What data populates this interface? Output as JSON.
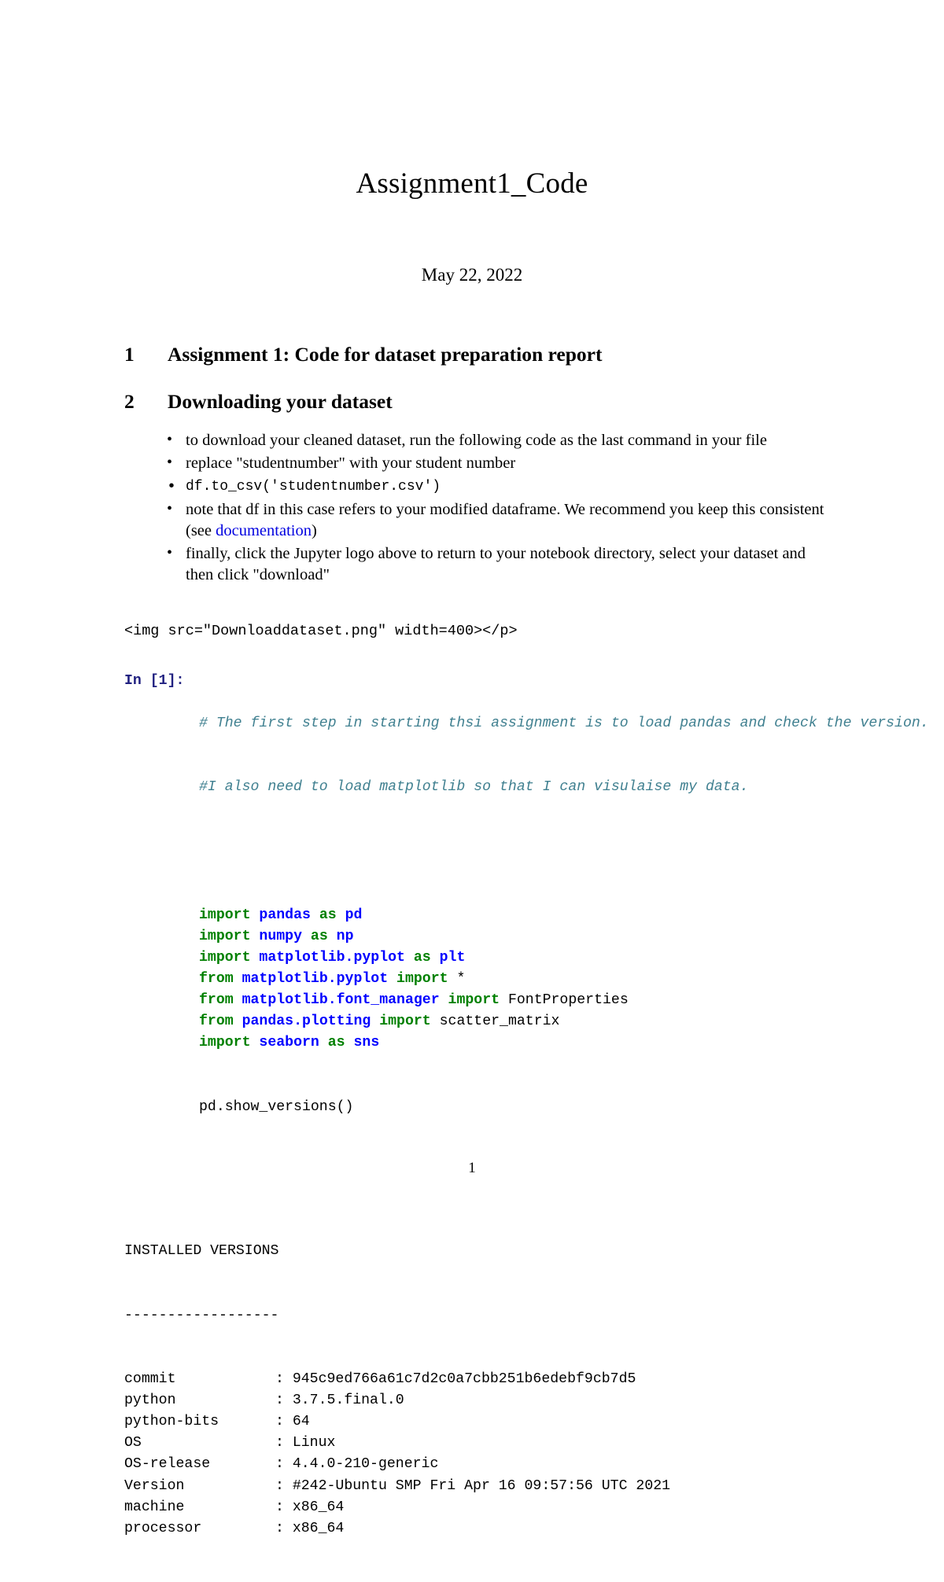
{
  "document": {
    "title": "Assignment1_Code",
    "date": "May 22, 2022",
    "page_number": "1"
  },
  "sections": [
    {
      "number": "1",
      "heading": "Assignment 1: Code for dataset preparation report"
    },
    {
      "number": "2",
      "heading": "Downloading your dataset"
    }
  ],
  "bullets": {
    "item1": "to download your cleaned dataset, run the following code as the last command in your file",
    "item2": "replace \"studentnumber\" with your student number",
    "item3": "df.to_csv('studentnumber.csv')",
    "item4_before": "note that df in this case refers to your modified dataframe.  We recommend you keep this consistent (see ",
    "item4_link": "documentation",
    "item4_after": ")",
    "item5": "finally, click the Jupyter logo above to return to your notebook directory, select your dataset and then click \"download\""
  },
  "raw_html_line": "<img src=\"Downloaddataset.png\" width=400></p>",
  "code_cell": {
    "prompt": "In [1]:",
    "comment_line1": "# The first step in starting thsi assignment is to load pandas and check the version.",
    "comment_line2": "#I also need to load matplotlib so that I can visulaise my data.",
    "lines": [
      {
        "kw1": "import",
        "mod1": " pandas",
        "kw2": " as",
        "mod2": " pd",
        "plain": ""
      },
      {
        "kw1": "import",
        "mod1": " numpy",
        "kw2": " as",
        "mod2": " np",
        "plain": ""
      },
      {
        "kw1": "import",
        "mod1": " matplotlib.pyplot",
        "kw2": " as",
        "mod2": " plt",
        "plain": ""
      },
      {
        "kw1": "from",
        "mod1": " matplotlib.pyplot",
        "kw2": " import",
        "mod2": "",
        "plain": " *"
      },
      {
        "kw1": "from",
        "mod1": " matplotlib.font_manager",
        "kw2": " import",
        "mod2": "",
        "plain": " FontProperties"
      },
      {
        "kw1": "from",
        "mod1": " pandas.plotting",
        "kw2": " import",
        "mod2": "",
        "plain": " scatter_matrix"
      },
      {
        "kw1": "import",
        "mod1": " seaborn",
        "kw2": " as",
        "mod2": " sns",
        "plain": ""
      }
    ],
    "final_call": "pd.show_versions()"
  },
  "output": {
    "header": "INSTALLED VERSIONS",
    "separator": "------------------",
    "rows": [
      {
        "key": "commit",
        "value": ": 945c9ed766a61c7d2c0a7cbb251b6edebf9cb7d5"
      },
      {
        "key": "python",
        "value": ": 3.7.5.final.0"
      },
      {
        "key": "python-bits",
        "value": ": 64"
      },
      {
        "key": "OS",
        "value": ": Linux"
      },
      {
        "key": "OS-release",
        "value": ": 4.4.0-210-generic"
      },
      {
        "key": "Version",
        "value": ": #242-Ubuntu SMP Fri Apr 16 09:57:56 UTC 2021"
      },
      {
        "key": "machine",
        "value": ": x86_64"
      },
      {
        "key": "processor",
        "value": ": x86_64"
      }
    ]
  },
  "colors": {
    "keyword": "#008000",
    "module": "#0000ff",
    "comment": "#408090",
    "prompt": "#202080",
    "link": "#0000e0"
  }
}
